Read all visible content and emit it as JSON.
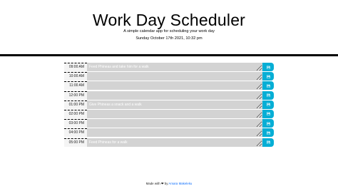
{
  "header": {
    "title": "Work Day Scheduler",
    "lead": "A simple calendar app for scheduling your work day",
    "current_day": "Sunday October 17th 2021, 10:32 pm"
  },
  "rows": [
    {
      "hour": "09:00 AM",
      "text": "Feed Phineas and take him for a walk"
    },
    {
      "hour": "10:00 AM",
      "text": ""
    },
    {
      "hour": "11:00 AM",
      "text": ""
    },
    {
      "hour": "12:00 PM",
      "text": ""
    },
    {
      "hour": "01:00 PM",
      "text": "Give Phineas a snack and a walk"
    },
    {
      "hour": "02:00 PM",
      "text": ""
    },
    {
      "hour": "03:00 PM",
      "text": ""
    },
    {
      "hour": "04:00 PM",
      "text": ""
    },
    {
      "hour": "05:00 PM",
      "text": "Feed Phineas for a walk"
    }
  ],
  "save_icon": "floppy-disk-icon",
  "colors": {
    "past": "#d3d3d3",
    "save": "#06aed5",
    "link": "#0d6efd"
  },
  "footer": {
    "made_with": "Made with",
    "heart": "❤",
    "by": "by",
    "author": "Amara Makeleku"
  }
}
